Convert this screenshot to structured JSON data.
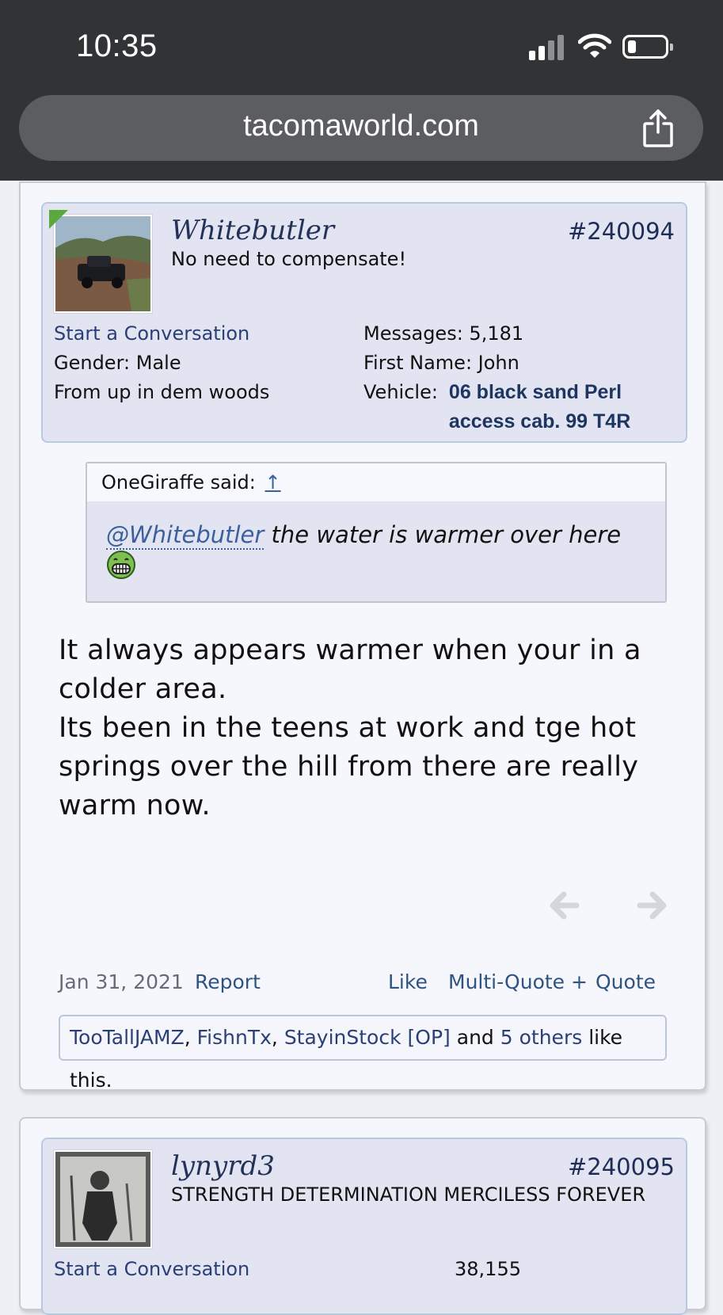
{
  "status": {
    "time": "10:35"
  },
  "browser": {
    "url": "tacomaworld.com"
  },
  "post1": {
    "username": "Whitebutler",
    "user_title": "No need to compensate!",
    "post_number": "#240094",
    "start_conversation": "Start a Conversation",
    "gender_label": "Gender:",
    "gender_value": "Male",
    "location": "From up in dem woods",
    "messages_label": "Messages:",
    "messages_value": "5,181",
    "first_name_label": "First Name:",
    "first_name_value": "John",
    "vehicle_label": "Vehicle:",
    "vehicle_line1": "06 black sand Perl",
    "vehicle_line2": "access cab. 99 T4R",
    "quote": {
      "author": "OneGiraffe said:",
      "arrow": "↑",
      "mention": "@Whitebutler",
      "text": " the water is warmer over here"
    },
    "message_lines": [
      "It always appears warmer when your in a",
      "colder area.",
      "Its been in the teens at work and tge hot",
      "springs over the hill from there are really",
      "warm now."
    ],
    "date": "Jan 31, 2021",
    "report": "Report",
    "like": "Like",
    "multiquote": "Multi-Quote +",
    "quote_btn": "Quote",
    "likes_bar": {
      "user1": "TooTallJAMZ",
      "user2": "FishnTx",
      "user3": "StayinStock",
      "op": "[OP]",
      "and": "and",
      "others": "5 others",
      "suffix": "like this."
    }
  },
  "post2": {
    "username": "lynyrd3",
    "user_title": "STRENGTH DETERMINATION MERCILESS FOREVER",
    "post_number": "#240095",
    "start_conversation": "Start a Conversation",
    "messages_value": "38,155"
  },
  "colors": {
    "link": "#2b3f77",
    "accent_online": "#5aa83e",
    "status_bar": "#323335"
  }
}
